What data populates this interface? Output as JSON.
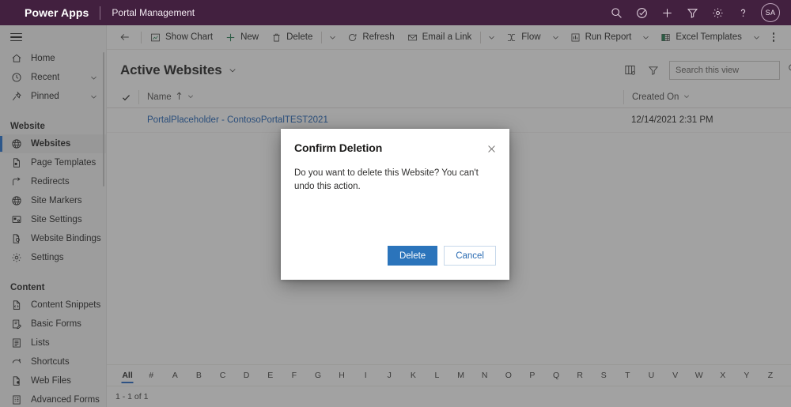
{
  "topbar": {
    "brand": "Power Apps",
    "app_name": "Portal Management",
    "icons": [
      {
        "name": "search-icon",
        "glyph": "search"
      },
      {
        "name": "wellness-check-icon",
        "glyph": "check-circle"
      },
      {
        "name": "add-icon",
        "glyph": "plus"
      },
      {
        "name": "filter-icon",
        "glyph": "funnel"
      },
      {
        "name": "settings-gear-icon",
        "glyph": "gear"
      },
      {
        "name": "help-icon",
        "glyph": "question"
      }
    ],
    "avatar_initials": "SA"
  },
  "sidebar": {
    "top_items": [
      {
        "label": "Home",
        "icon": "home-icon",
        "expandable": false
      },
      {
        "label": "Recent",
        "icon": "clock-icon",
        "expandable": true
      },
      {
        "label": "Pinned",
        "icon": "pin-icon",
        "expandable": true
      }
    ],
    "groups": [
      {
        "title": "Website",
        "items": [
          {
            "label": "Websites",
            "icon": "globe-icon",
            "selected": true
          },
          {
            "label": "Page Templates",
            "icon": "page-template-icon",
            "selected": false
          },
          {
            "label": "Redirects",
            "icon": "redirect-arrow-icon",
            "selected": false
          },
          {
            "label": "Site Markers",
            "icon": "globe-marker-icon",
            "selected": false
          },
          {
            "label": "Site Settings",
            "icon": "site-settings-icon",
            "selected": false
          },
          {
            "label": "Website Bindings",
            "icon": "website-binding-icon",
            "selected": false
          },
          {
            "label": "Settings",
            "icon": "gear-icon",
            "selected": false
          }
        ]
      },
      {
        "title": "Content",
        "items": [
          {
            "label": "Content Snippets",
            "icon": "content-snippet-icon",
            "selected": false
          },
          {
            "label": "Basic Forms",
            "icon": "basic-form-icon",
            "selected": false
          },
          {
            "label": "Lists",
            "icon": "list-icon",
            "selected": false
          },
          {
            "label": "Shortcuts",
            "icon": "shortcut-icon",
            "selected": false
          },
          {
            "label": "Web Files",
            "icon": "web-file-icon",
            "selected": false
          },
          {
            "label": "Advanced Forms",
            "icon": "advanced-form-icon",
            "selected": false
          }
        ]
      }
    ]
  },
  "commandbar": {
    "back_label": "Back",
    "commands": [
      {
        "label": "Show Chart",
        "icon": "show-chart-icon",
        "caret": false
      },
      {
        "label": "New",
        "icon": "plus-icon",
        "caret": false
      },
      {
        "label": "Delete",
        "icon": "trash-icon",
        "caret": true
      },
      {
        "label": "Refresh",
        "icon": "refresh-icon",
        "caret": false
      },
      {
        "label": "Email a Link",
        "icon": "email-link-icon",
        "caret": true
      },
      {
        "label": "Flow",
        "icon": "flow-icon",
        "caret": true
      },
      {
        "label": "Run Report",
        "icon": "run-report-icon",
        "caret": true
      },
      {
        "label": "Excel Templates",
        "icon": "excel-icon",
        "caret": true
      }
    ],
    "overflow_label": "More commands"
  },
  "view": {
    "title": "Active Websites",
    "edit_columns_label": "Edit columns",
    "edit_filters_label": "Edit filters",
    "search": {
      "placeholder": "Search this view",
      "value": ""
    }
  },
  "grid": {
    "columns": [
      {
        "label": "Name",
        "sort": "ascending"
      },
      {
        "label": "Created On",
        "sort": "none"
      }
    ],
    "rows": [
      {
        "name": "PortalPlaceholder - ContosoPortalTEST2021",
        "created_on": "12/14/2021 2:31 PM"
      }
    ]
  },
  "alphabar": {
    "items": [
      "All",
      "#",
      "A",
      "B",
      "C",
      "D",
      "E",
      "F",
      "G",
      "H",
      "I",
      "J",
      "K",
      "L",
      "M",
      "N",
      "O",
      "P",
      "Q",
      "R",
      "S",
      "T",
      "U",
      "V",
      "W",
      "X",
      "Y",
      "Z"
    ],
    "active": "All"
  },
  "statusbar": {
    "record_count": "1 - 1 of 1"
  },
  "dialog": {
    "title": "Confirm Deletion",
    "message": "Do you want to delete this Website? You can't undo this action.",
    "close_label": "Close",
    "primary_button": "Delete",
    "secondary_button": "Cancel"
  },
  "colors": {
    "header_purple": "#42203F",
    "primary_blue": "#2b74bb",
    "link_blue": "#1a5fb4",
    "selection_accent": "#1F6FD1"
  }
}
